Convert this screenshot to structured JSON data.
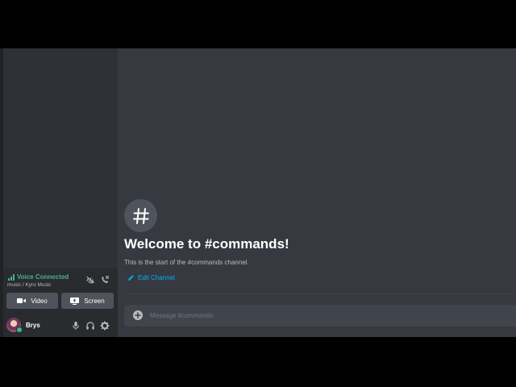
{
  "colors": {
    "background": "#36393f",
    "sidebar": "#2f3136",
    "panel": "#292b2f",
    "accent_green": "#43b581",
    "link": "#00b0f4",
    "text_muted": "#b9bbbe",
    "text_white": "#ffffff"
  },
  "voice_panel": {
    "status": "Voice Connected",
    "channel": "music / Kyro Music",
    "video_label": "Video",
    "screen_label": "Screen",
    "icons": [
      "signal-icon",
      "noise-suppression-icon",
      "disconnect-icon",
      "video-camera-icon",
      "screen-share-icon"
    ]
  },
  "user_panel": {
    "username": "Brys",
    "status": "online",
    "icons": [
      "microphone-icon",
      "headphones-icon",
      "settings-gear-icon"
    ]
  },
  "chat": {
    "welcome_title": "Welcome to #commands!",
    "welcome_subtitle": "This is the start of the #commands channel.",
    "edit_channel_label": "Edit Channel",
    "composer_placeholder": "Message #commands"
  }
}
